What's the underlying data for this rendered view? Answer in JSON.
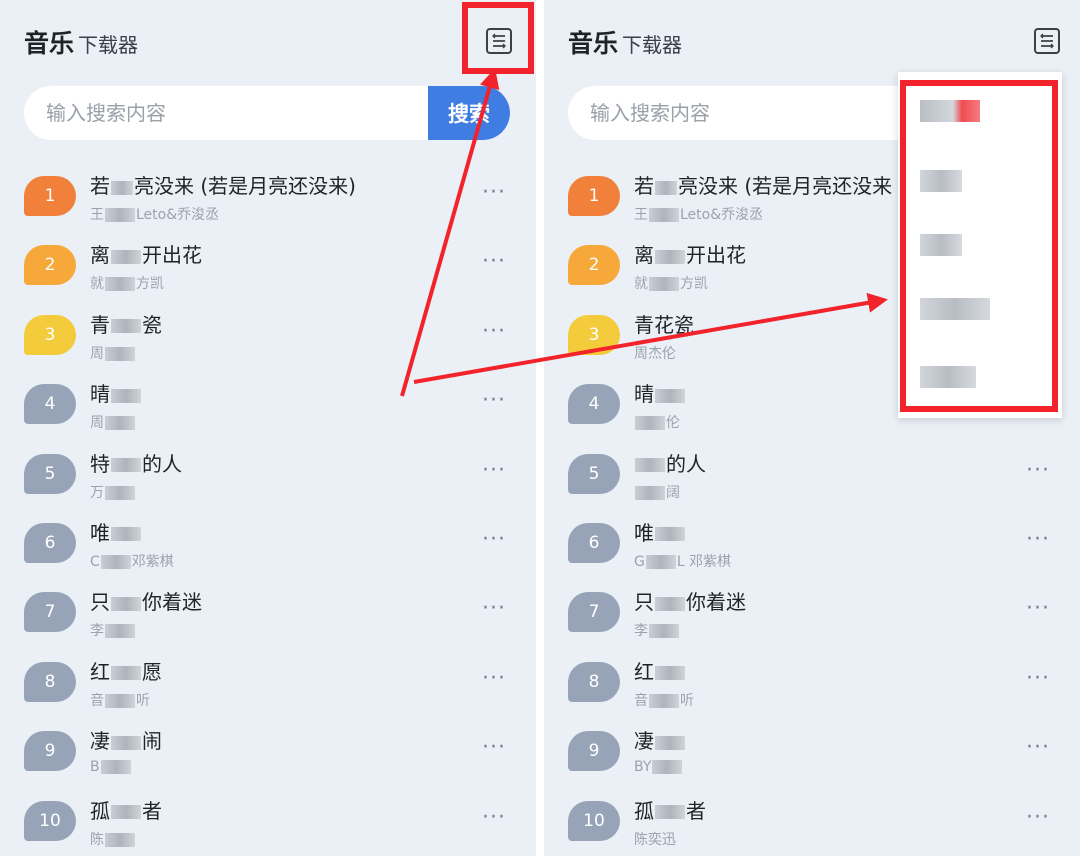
{
  "app": {
    "title": "音乐",
    "subtitle": "下载器"
  },
  "search": {
    "placeholder": "输入搜索内容",
    "button_label": "搜索"
  },
  "icons": {
    "menu": "sort-menu-icon",
    "more": "ellipsis-icon"
  },
  "colors": {
    "panel_bg": "#eaf0f6",
    "rank_1": "#f0803a",
    "rank_2": "#f6a93a",
    "rank_3": "#f4cb3a",
    "rank_other": "#97a4b7",
    "search_button": "#3f7de3",
    "callout": "#f2232a"
  },
  "more_label": "···",
  "left_panel": {
    "songs": [
      {
        "rank": "1",
        "title_a": "若",
        "title_b": "亮没来 (若是月亮还没来)",
        "artist_a": "王",
        "artist_b": "Leto&乔浚丞"
      },
      {
        "rank": "2",
        "title_a": "离",
        "title_b": "开出花",
        "artist_a": "就",
        "artist_b": "方凯"
      },
      {
        "rank": "3",
        "title_a": "青",
        "title_b": "瓷",
        "artist_a": "周",
        "artist_b": ""
      },
      {
        "rank": "4",
        "title_a": "晴",
        "title_b": "",
        "artist_a": "周",
        "artist_b": ""
      },
      {
        "rank": "5",
        "title_a": "特",
        "title_b": "的人",
        "artist_a": "万",
        "artist_b": ""
      },
      {
        "rank": "6",
        "title_a": "唯",
        "title_b": "",
        "artist_a": "C",
        "artist_b": "邓紫棋"
      },
      {
        "rank": "7",
        "title_a": "只",
        "title_b": "你着迷",
        "artist_a": "李",
        "artist_b": ""
      },
      {
        "rank": "8",
        "title_a": "红",
        "title_b": "愿",
        "artist_a": "音",
        "artist_b": "听"
      },
      {
        "rank": "9",
        "title_a": "凄",
        "title_b": "闹",
        "artist_a": "B",
        "artist_b": ""
      },
      {
        "rank": "10",
        "title_a": "孤",
        "title_b": "者",
        "artist_a": "陈",
        "artist_b": ""
      }
    ]
  },
  "right_panel": {
    "songs": [
      {
        "rank": "1",
        "title_a": "若",
        "title_b": "亮没来 (若是月亮还没来",
        "artist_a": "王",
        "artist_b": "Leto&乔浚丞"
      },
      {
        "rank": "2",
        "title_a": "离",
        "title_b": "开出花",
        "artist_a": "就",
        "artist_b": "方凯"
      },
      {
        "rank": "3",
        "title_a": "青花瓷",
        "title_b": "",
        "artist_a": "周杰伦",
        "artist_b": ""
      },
      {
        "rank": "4",
        "title_a": "晴",
        "title_b": "",
        "artist_a": "",
        "artist_b": "伦"
      },
      {
        "rank": "5",
        "title_a": "",
        "title_b": "的人",
        "artist_a": "",
        "artist_b": "阔"
      },
      {
        "rank": "6",
        "title_a": "唯",
        "title_b": "",
        "artist_a": "G",
        "artist_b": "L 邓紫棋"
      },
      {
        "rank": "7",
        "title_a": "只",
        "title_b": "你着迷",
        "artist_a": "李",
        "artist_b": ""
      },
      {
        "rank": "8",
        "title_a": "红",
        "title_b": "",
        "artist_a": "音",
        "artist_b": "听"
      },
      {
        "rank": "9",
        "title_a": "凄",
        "title_b": "",
        "artist_a": "BY",
        "artist_b": ""
      },
      {
        "rank": "10",
        "title_a": "孤",
        "title_b": "者",
        "artist_a": "陈奕迅",
        "artist_b": ""
      }
    ],
    "dropdown_items": [
      "",
      "",
      "",
      "",
      ""
    ]
  }
}
